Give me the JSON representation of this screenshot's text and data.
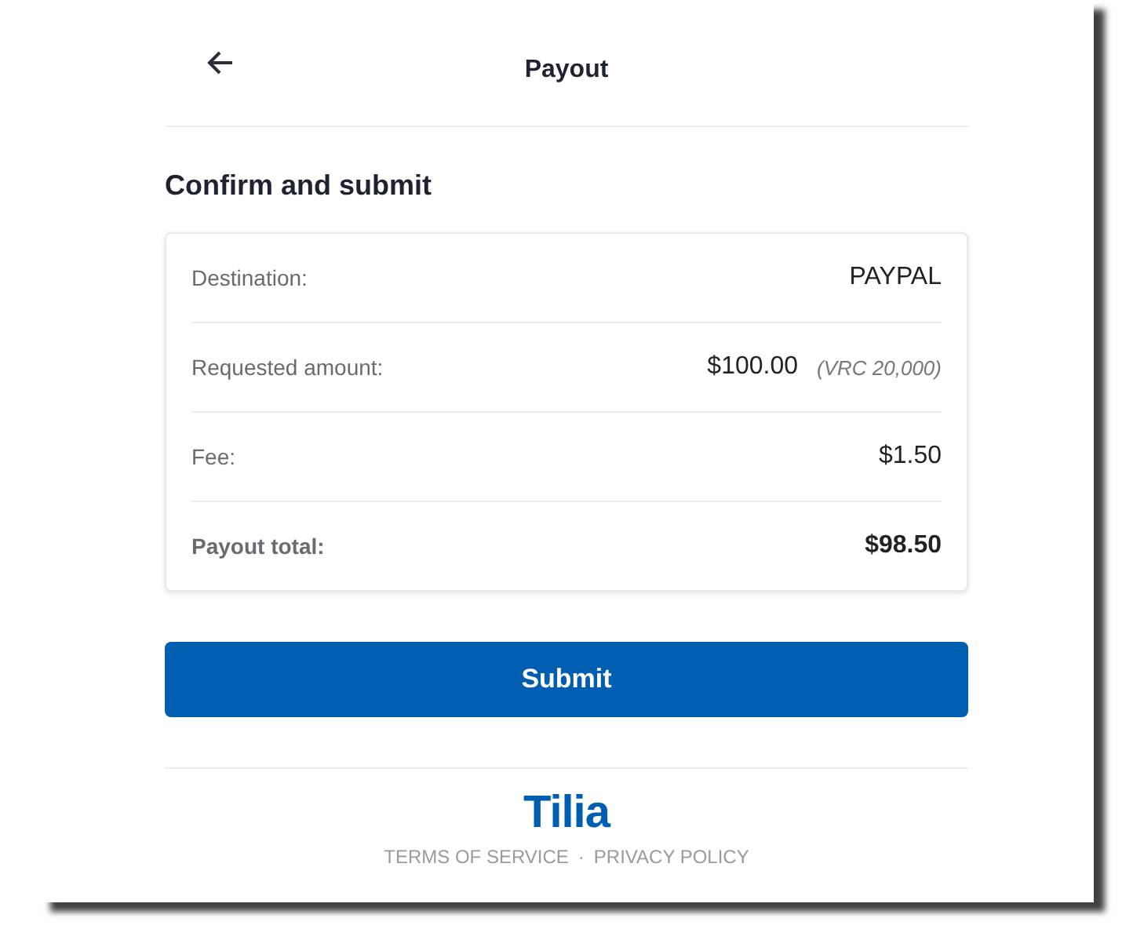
{
  "header": {
    "title": "Payout"
  },
  "section_title": "Confirm and submit",
  "summary": [
    {
      "label": "Destination:",
      "value": "PAYPAL",
      "kind": "normal"
    },
    {
      "label": "Requested amount:",
      "value": "$100.00",
      "note": "(VRC 20,000)",
      "kind": "normal"
    },
    {
      "label": "Fee:",
      "value": "$1.50",
      "kind": "normal"
    },
    {
      "label": "Payout total:",
      "value": "$98.50",
      "kind": "total"
    }
  ],
  "submit_button": "Submit",
  "footer": {
    "logo": "Tilia",
    "links": [
      "TERMS OF SERVICE",
      "PRIVACY POLICY"
    ],
    "separator": "·"
  }
}
